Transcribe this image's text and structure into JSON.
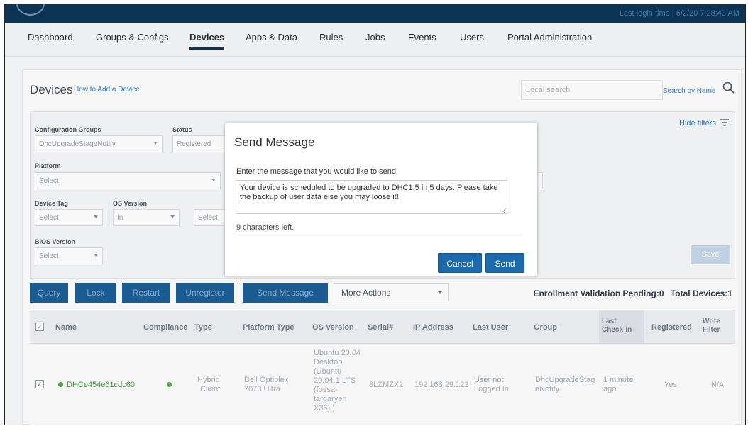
{
  "topbar": {
    "last_login": "Last login time | 6/2/20 7:28:43 AM"
  },
  "nav": {
    "items": [
      {
        "label": "Dashboard"
      },
      {
        "label": "Groups & Configs"
      },
      {
        "label": "Devices"
      },
      {
        "label": "Apps & Data"
      },
      {
        "label": "Rules"
      },
      {
        "label": "Jobs"
      },
      {
        "label": "Events"
      },
      {
        "label": "Users"
      },
      {
        "label": "Portal Administration"
      }
    ],
    "active": "Devices"
  },
  "devices": {
    "title": "Devices",
    "help_link": "How to Add a Device",
    "search_placeholder": "Local search",
    "search_by": "Search by Name"
  },
  "filters": {
    "config_groups_label": "Configuration Groups",
    "config_groups_value": "DhcUpgradeStageNotify",
    "status_label": "Status",
    "status_value": "Registered",
    "platform_label": "Platform",
    "platform_value": "Select",
    "device_tag_label": "Device Tag",
    "device_tag_value": "Select",
    "os_version_label": "OS Version",
    "os_version_op": "In",
    "os_version_value": "Select",
    "bios_label": "BIOS Version",
    "bios_value": "Select",
    "hide_filters": "Hide filters",
    "save": "Save"
  },
  "actions": {
    "query": "Query",
    "lock": "Lock",
    "restart": "Restart",
    "unregister": "Unregister",
    "send_message": "Send Message",
    "more_actions": "More Actions",
    "enrollment_pending": "Enrollment Validation Pending:0",
    "total_devices": "Total Devices:1"
  },
  "table": {
    "headers": {
      "name": "Name",
      "compliance": "Compliance",
      "type": "Type",
      "platform_type": "Platform Type",
      "os_version": "OS Version",
      "serial": "Serial#",
      "ip": "IP Address",
      "last_user": "Last User",
      "group": "Group",
      "last_checkin_1": "Last",
      "last_checkin_2": "Check-in",
      "registered": "Registered",
      "write_filter_1": "Write",
      "write_filter_2": "Filter"
    },
    "row": {
      "name": "DHCe454e61cdc60",
      "type_1": "Hybrid",
      "type_2": "Client",
      "platform_1": "Dell Optiplex",
      "platform_2": "7070 Ultra",
      "os": [
        "Ubuntu 20.04",
        "Desktop",
        "(Ubuntu",
        "20.04.1 LTS",
        "(fossa-",
        "targaryen",
        "X36) )"
      ],
      "serial": "8LZMZX2",
      "ip": "192.168.29.122",
      "last_user_1": "User not",
      "last_user_2": "Logged In",
      "group_1": "DhcUpgradeStag",
      "group_2": "eNotify",
      "checkin_1": "1 minute",
      "checkin_2": "ago",
      "registered": "Yes",
      "write_filter": "N/A"
    }
  },
  "modal": {
    "title": "Send Message",
    "prompt": "Enter the message that you would like to send:",
    "message": "Your device is scheduled to be upgraded to DHC1.5 in 5 days. Please take the backup of user data else you may loose it!",
    "chars_left": "9 characters left.",
    "cancel": "Cancel",
    "send": "Send"
  }
}
